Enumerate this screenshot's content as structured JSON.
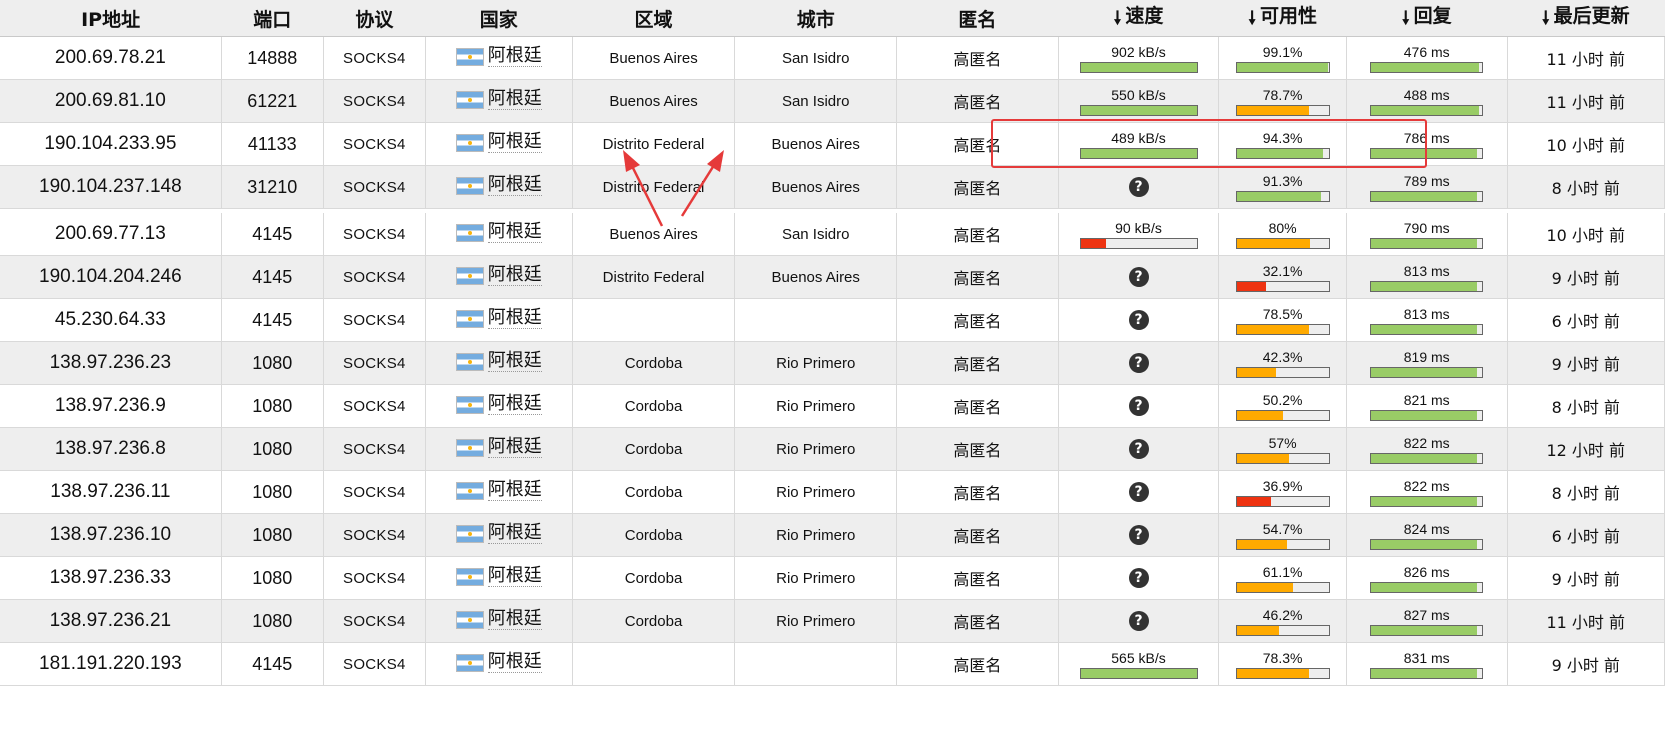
{
  "headers": {
    "ip": "IP地址",
    "port": "端口",
    "protocol": "协议",
    "country": "国家",
    "region": "区域",
    "city": "城市",
    "anonymity": "匿名",
    "speed": "速度",
    "availability": "可用性",
    "response": "回复",
    "last_update": "最后更新",
    "sort_icon": "down-arrow-icon"
  },
  "colors": {
    "green": "#99cc66",
    "orange": "#ffaa00",
    "red": "#ee3311",
    "highlight": "#e53a3a"
  },
  "unknown_glyph": "?",
  "rows": [
    {
      "ip": "200.69.78.21",
      "port": "14888",
      "protocol": "SOCKS4",
      "country": "阿根廷",
      "region": "Buenos Aires",
      "city": "San Isidro",
      "anonymity": "高匿名",
      "speed": "902 kB/s",
      "speed_pct": 100,
      "speed_color": "green",
      "avail": "99.1%",
      "avail_pct": 99.1,
      "avail_color": "green",
      "resp": "476 ms",
      "resp_pct": 97,
      "update": "11 小时 前"
    },
    {
      "ip": "200.69.81.10",
      "port": "61221",
      "protocol": "SOCKS4",
      "country": "阿根廷",
      "region": "Buenos Aires",
      "city": "San Isidro",
      "anonymity": "高匿名",
      "speed": "550 kB/s",
      "speed_pct": 100,
      "speed_color": "green",
      "avail": "78.7%",
      "avail_pct": 78.7,
      "avail_color": "orange",
      "resp": "488 ms",
      "resp_pct": 97,
      "update": "11 小时 前"
    },
    {
      "ip": "190.104.233.95",
      "port": "41133",
      "protocol": "SOCKS4",
      "country": "阿根廷",
      "region": "Distrito Federal",
      "city": "Buenos Aires",
      "anonymity": "高匿名",
      "speed": "489 kB/s",
      "speed_pct": 100,
      "speed_color": "green",
      "avail": "94.3%",
      "avail_pct": 94.3,
      "avail_color": "green",
      "resp": "786 ms",
      "resp_pct": 95,
      "update": "10 小时 前"
    },
    {
      "ip": "190.104.237.148",
      "port": "31210",
      "protocol": "SOCKS4",
      "country": "阿根廷",
      "region": "Distrito Federal",
      "city": "Buenos Aires",
      "anonymity": "高匿名",
      "speed": "",
      "speed_pct": null,
      "speed_color": "",
      "avail": "91.3%",
      "avail_pct": 91.3,
      "avail_color": "green",
      "resp": "789 ms",
      "resp_pct": 95,
      "update": "8 小时 前"
    },
    {
      "ip": "200.69.77.13",
      "port": "4145",
      "protocol": "SOCKS4",
      "country": "阿根廷",
      "region": "Buenos Aires",
      "city": "San Isidro",
      "anonymity": "高匿名",
      "speed": "90 kB/s",
      "speed_pct": 22,
      "speed_color": "red",
      "avail": "80%",
      "avail_pct": 80,
      "avail_color": "orange",
      "resp": "790 ms",
      "resp_pct": 95,
      "update": "10 小时 前"
    },
    {
      "ip": "190.104.204.246",
      "port": "4145",
      "protocol": "SOCKS4",
      "country": "阿根廷",
      "region": "Distrito Federal",
      "city": "Buenos Aires",
      "anonymity": "高匿名",
      "speed": "",
      "speed_pct": null,
      "speed_color": "",
      "avail": "32.1%",
      "avail_pct": 32.1,
      "avail_color": "red",
      "resp": "813 ms",
      "resp_pct": 95,
      "update": "9 小时 前"
    },
    {
      "ip": "45.230.64.33",
      "port": "4145",
      "protocol": "SOCKS4",
      "country": "阿根廷",
      "region": "",
      "city": "",
      "anonymity": "高匿名",
      "speed": "",
      "speed_pct": null,
      "speed_color": "",
      "avail": "78.5%",
      "avail_pct": 78.5,
      "avail_color": "orange",
      "resp": "813 ms",
      "resp_pct": 95,
      "update": "6 小时 前"
    },
    {
      "ip": "138.97.236.23",
      "port": "1080",
      "protocol": "SOCKS4",
      "country": "阿根廷",
      "region": "Cordoba",
      "city": "Rio Primero",
      "anonymity": "高匿名",
      "speed": "",
      "speed_pct": null,
      "speed_color": "",
      "avail": "42.3%",
      "avail_pct": 42.3,
      "avail_color": "orange",
      "resp": "819 ms",
      "resp_pct": 95,
      "update": "9 小时 前"
    },
    {
      "ip": "138.97.236.9",
      "port": "1080",
      "protocol": "SOCKS4",
      "country": "阿根廷",
      "region": "Cordoba",
      "city": "Rio Primero",
      "anonymity": "高匿名",
      "speed": "",
      "speed_pct": null,
      "speed_color": "",
      "avail": "50.2%",
      "avail_pct": 50.2,
      "avail_color": "orange",
      "resp": "821 ms",
      "resp_pct": 95,
      "update": "8 小时 前"
    },
    {
      "ip": "138.97.236.8",
      "port": "1080",
      "protocol": "SOCKS4",
      "country": "阿根廷",
      "region": "Cordoba",
      "city": "Rio Primero",
      "anonymity": "高匿名",
      "speed": "",
      "speed_pct": null,
      "speed_color": "",
      "avail": "57%",
      "avail_pct": 57,
      "avail_color": "orange",
      "resp": "822 ms",
      "resp_pct": 95,
      "update": "12 小时 前"
    },
    {
      "ip": "138.97.236.11",
      "port": "1080",
      "protocol": "SOCKS4",
      "country": "阿根廷",
      "region": "Cordoba",
      "city": "Rio Primero",
      "anonymity": "高匿名",
      "speed": "",
      "speed_pct": null,
      "speed_color": "",
      "avail": "36.9%",
      "avail_pct": 36.9,
      "avail_color": "red",
      "resp": "822 ms",
      "resp_pct": 95,
      "update": "8 小时 前"
    },
    {
      "ip": "138.97.236.10",
      "port": "1080",
      "protocol": "SOCKS4",
      "country": "阿根廷",
      "region": "Cordoba",
      "city": "Rio Primero",
      "anonymity": "高匿名",
      "speed": "",
      "speed_pct": null,
      "speed_color": "",
      "avail": "54.7%",
      "avail_pct": 54.7,
      "avail_color": "orange",
      "resp": "824 ms",
      "resp_pct": 95,
      "update": "6 小时 前"
    },
    {
      "ip": "138.97.236.33",
      "port": "1080",
      "protocol": "SOCKS4",
      "country": "阿根廷",
      "region": "Cordoba",
      "city": "Rio Primero",
      "anonymity": "高匿名",
      "speed": "",
      "speed_pct": null,
      "speed_color": "",
      "avail": "61.1%",
      "avail_pct": 61.1,
      "avail_color": "orange",
      "resp": "826 ms",
      "resp_pct": 95,
      "update": "9 小时 前"
    },
    {
      "ip": "138.97.236.21",
      "port": "1080",
      "protocol": "SOCKS4",
      "country": "阿根廷",
      "region": "Cordoba",
      "city": "Rio Primero",
      "anonymity": "高匿名",
      "speed": "",
      "speed_pct": null,
      "speed_color": "",
      "avail": "46.2%",
      "avail_pct": 46.2,
      "avail_color": "orange",
      "resp": "827 ms",
      "resp_pct": 95,
      "update": "11 小时 前"
    },
    {
      "ip": "181.191.220.193",
      "port": "4145",
      "protocol": "SOCKS4",
      "country": "阿根廷",
      "region": "",
      "city": "",
      "anonymity": "高匿名",
      "speed": "565 kB/s",
      "speed_pct": 100,
      "speed_color": "green",
      "avail": "78.3%",
      "avail_pct": 78.3,
      "avail_color": "orange",
      "resp": "831 ms",
      "resp_pct": 95,
      "update": "9 小时 前"
    }
  ]
}
